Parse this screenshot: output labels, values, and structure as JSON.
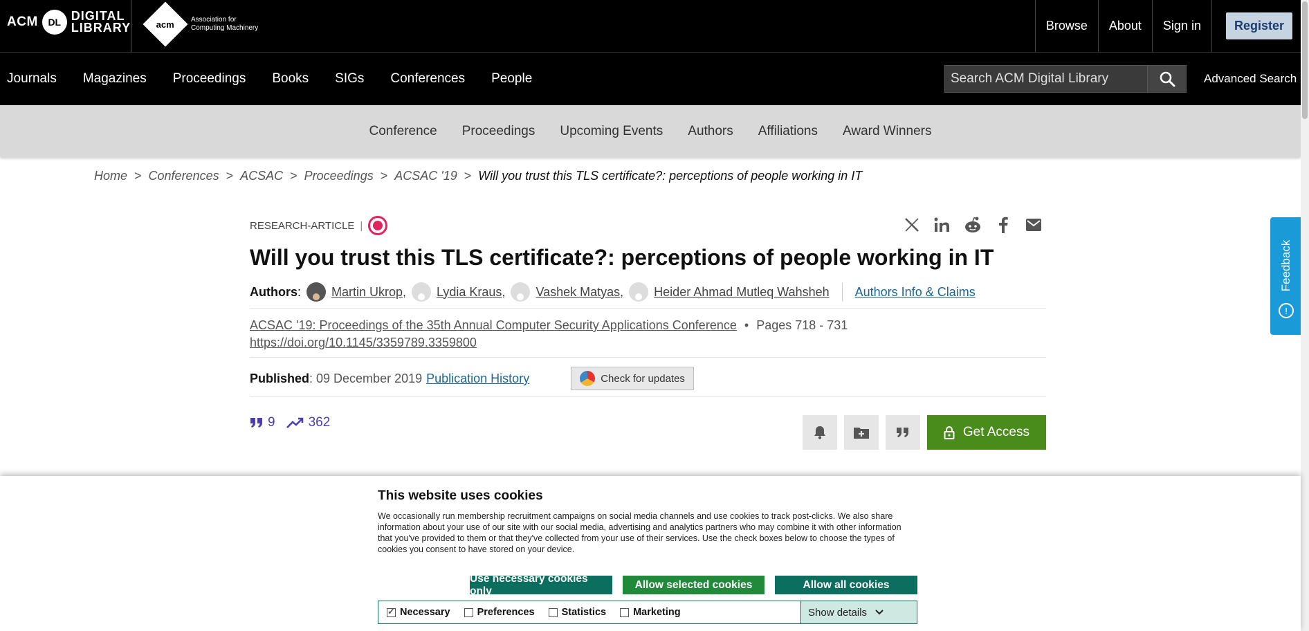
{
  "header": {
    "logo_acm": "ACM",
    "logo_dl": "DL",
    "logo_digital": "DIGITAL",
    "logo_library": "LIBRARY",
    "acm_mark": "acm",
    "assoc_line1": "Association for",
    "assoc_line2": "Computing Machinery",
    "links": [
      "Browse",
      "About",
      "Sign in"
    ],
    "register": "Register"
  },
  "nav": {
    "items": [
      "Journals",
      "Magazines",
      "Proceedings",
      "Books",
      "SIGs",
      "Conferences",
      "People"
    ],
    "search_placeholder": "Search ACM Digital Library",
    "advanced_search": "Advanced Search"
  },
  "subnav": {
    "items": [
      "Conference",
      "Proceedings",
      "Upcoming Events",
      "Authors",
      "Affiliations",
      "Award Winners"
    ]
  },
  "breadcrumb": {
    "items": [
      "Home",
      "Conferences",
      "ACSAC",
      "Proceedings",
      "ACSAC '19"
    ],
    "current": "Will you trust this TLS certificate?: perceptions of people working in IT",
    "separator": ">"
  },
  "article": {
    "type": "RESEARCH-ARTICLE",
    "type_sep": "|",
    "title": "Will you trust this TLS certificate?: perceptions of people working in IT",
    "authors_label": "Authors",
    "authors_colon": ":",
    "authors": [
      "Martin Ukrop,",
      "Lydia Kraus,",
      "Vashek Matyas,",
      "Heider Ahmad Mutleq Wahsheh"
    ],
    "authors_info": "Authors Info & Claims",
    "proceedings": "ACSAC '19: Proceedings of the 35th Annual Computer Security Applications Conference",
    "bullet": "•",
    "pages": "Pages 718 - 731",
    "doi": "https://doi.org/10.1145/3359789.3359800",
    "published_label": "Published",
    "published_date": ": 09 December 2019",
    "publication_history": "Publication History",
    "check_updates": "Check for updates",
    "citations": "9",
    "downloads": "362",
    "get_access": "Get Access"
  },
  "feedback": {
    "label": "Feedback"
  },
  "cookie": {
    "title": "This website uses cookies",
    "text": "We occasionally run membership recruitment campaigns on social media channels and use cookies to track post-clicks. We also share information about your use of our site with our social media, advertising and analytics partners who may combine it with other information that you've provided to them or that they've collected from your use of their services. Use the check boxes below to choose the types of cookies you consent to have stored on your device.",
    "btn_necessary": "Use necessary cookies only",
    "btn_selected": "Allow selected cookies",
    "btn_all": "Allow all cookies",
    "checks": [
      "Necessary",
      "Preferences",
      "Statistics",
      "Marketing"
    ],
    "show_details": "Show details"
  },
  "colors": {
    "get_access": "#4a8c1c",
    "cookie_btn": "#0b6e5e",
    "feedback": "#1a9ad6",
    "link": "#1a6699"
  }
}
